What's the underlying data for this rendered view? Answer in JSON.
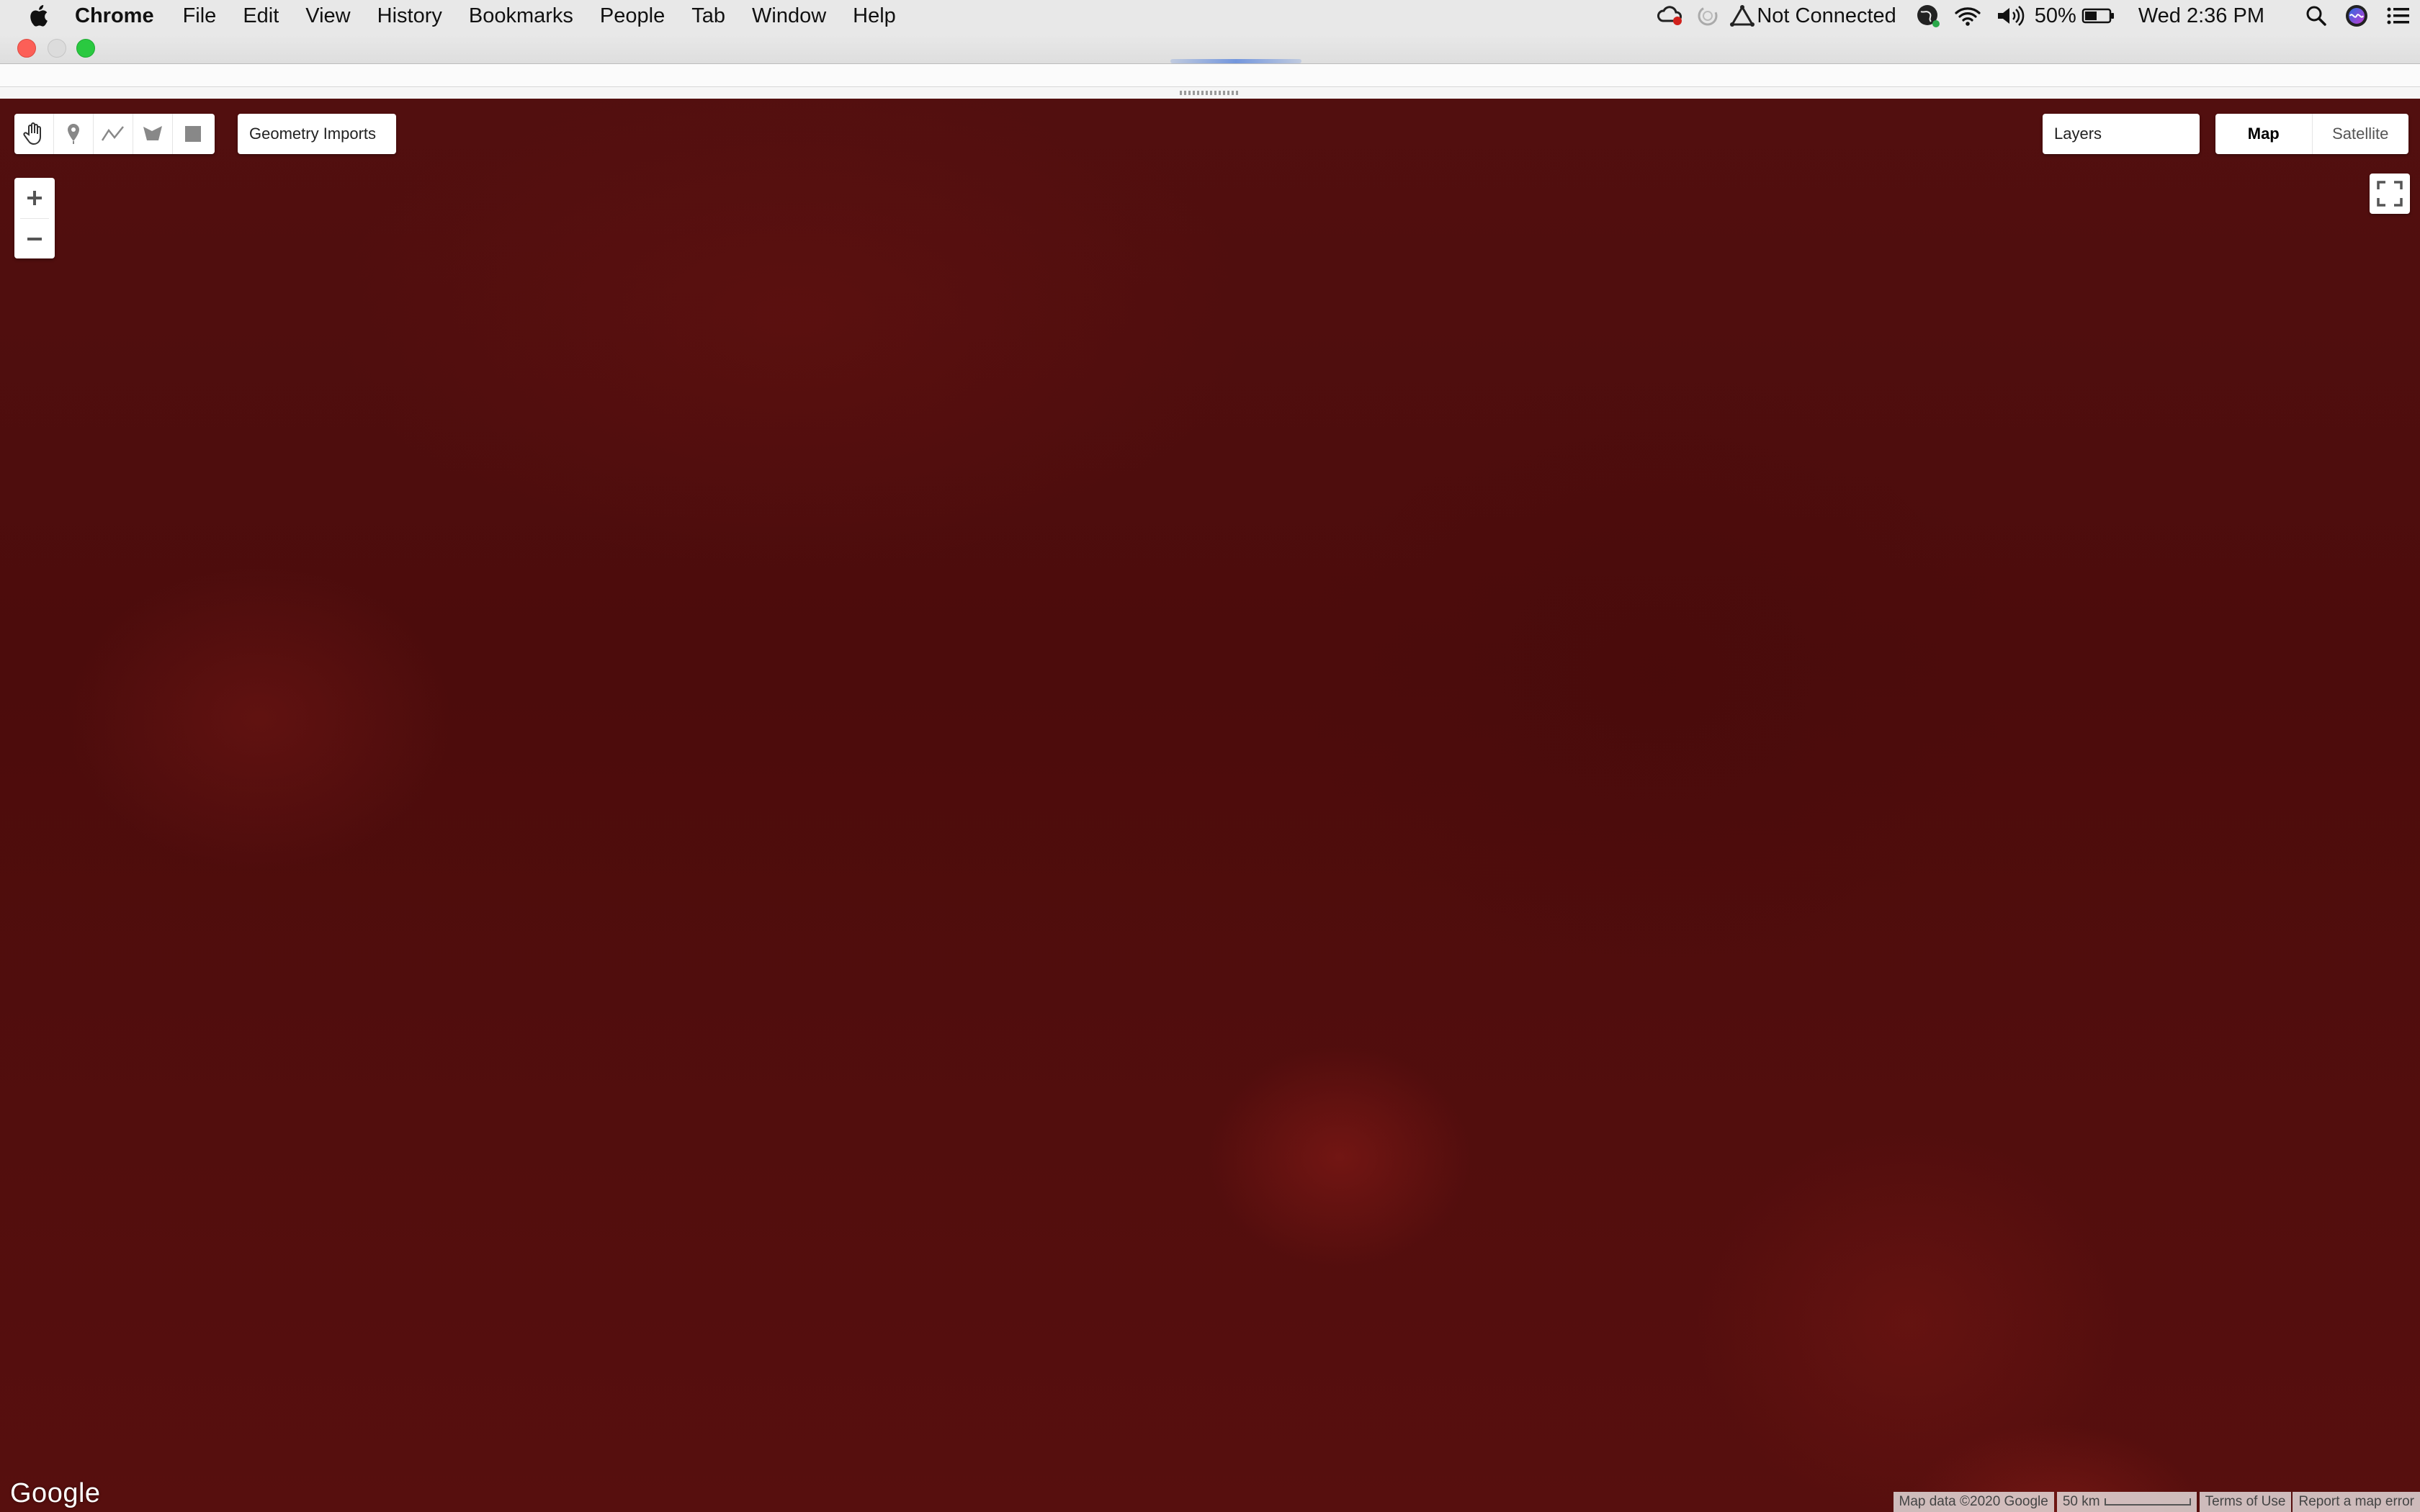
{
  "menubar": {
    "app_name": "Chrome",
    "menus": [
      "File",
      "Edit",
      "View",
      "History",
      "Bookmarks",
      "People",
      "Tab",
      "Window",
      "Help"
    ],
    "status": {
      "vpn_label": "Not Connected",
      "battery": "50%",
      "clock": "Wed 2:36 PM"
    },
    "icons": [
      "apple-icon",
      "creative-cloud-icon",
      "sync-icon",
      "vpn-icon",
      "globe-icon",
      "wifi-icon",
      "volume-icon",
      "battery-icon",
      "spotlight-icon",
      "siri-icon",
      "notification-center-icon"
    ]
  },
  "map": {
    "drawing_tools": [
      "hand-tool",
      "marker-tool",
      "line-tool",
      "polygon-tool",
      "rectangle-tool"
    ],
    "geometry_imports_label": "Geometry Imports",
    "layers_label": "Layers",
    "map_types": [
      {
        "label": "Map",
        "active": true
      },
      {
        "label": "Satellite",
        "active": false
      }
    ],
    "zoom_in": "+",
    "zoom_out": "−",
    "logo": "Google",
    "footer": {
      "map_data": "Map data ©2020 Google",
      "scale_label": "50 km",
      "terms": "Terms of Use",
      "report": "Report a map error"
    },
    "colors": {
      "overlay": "#4a0b0b"
    }
  }
}
